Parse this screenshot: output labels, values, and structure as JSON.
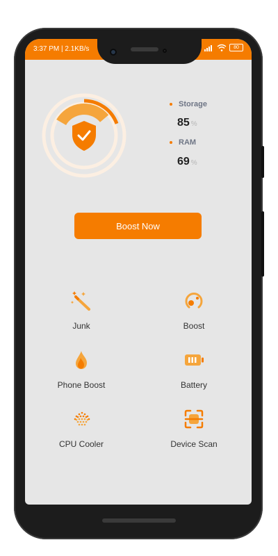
{
  "status_bar": {
    "time_speed": "3:37 PM | 2.1KB/s",
    "icons": [
      "bluetooth-icon",
      "signal-icon",
      "signal-icon",
      "wifi-icon",
      "battery-icon"
    ],
    "battery_text": "80"
  },
  "gauge": {
    "storage_fraction": 0.85,
    "ram_fraction": 0.69,
    "center_icon": "shield-check-icon"
  },
  "legend": {
    "storage_label": "Storage",
    "storage_value": "85",
    "ram_label": "RAM",
    "ram_value": "69",
    "unit": "%"
  },
  "boost_button": {
    "label": "Boost Now"
  },
  "features": [
    {
      "label": "Junk",
      "icon": "magic-wand-icon"
    },
    {
      "label": "Boost",
      "icon": "speed-dial-icon"
    },
    {
      "label": "Phone Boost",
      "icon": "flame-icon"
    },
    {
      "label": "Battery",
      "icon": "battery-icon"
    },
    {
      "label": "CPU Cooler",
      "icon": "cpu-cooler-icon"
    },
    {
      "label": "Device Scan",
      "icon": "device-scan-icon"
    }
  ],
  "colors": {
    "accent": "#f57c00",
    "accent_light": "#f5a53c",
    "ring_pale": "#fcefe2",
    "background": "#e6e6e6"
  }
}
